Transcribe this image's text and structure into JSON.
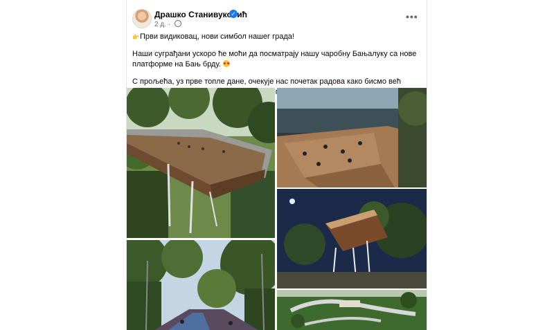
{
  "post": {
    "author": "Драшко Станивуковић",
    "time": "2 д.",
    "more_label": "•••",
    "paragraphs": [
      "Први видиковац, нови симбол нашег града!",
      "Наши суграђани ускоро ће моћи да посматрају нашу чаробну Бањалуку са нове платформе на Бањ брду.",
      "С прољећа, уз прве топле дане, очекује нас почетак радова како бисмо већ током љета уживали у погледу на најљепши град..."
    ]
  },
  "icons": {
    "verified": "verified-badge-icon",
    "audience": "globe-icon",
    "emoji_first": "pointing-hand-emoji",
    "emoji_second": "heart-eyes-emoji"
  },
  "colors": {
    "accent": "#1877f2",
    "secondary_text": "#65676b",
    "text": "#050505"
  },
  "photos": [
    "viewing-platform-daytime-render",
    "platform-deck-with-people-render",
    "platform-night-render",
    "walkway-under-trees-render",
    "aerial-site-render"
  ]
}
